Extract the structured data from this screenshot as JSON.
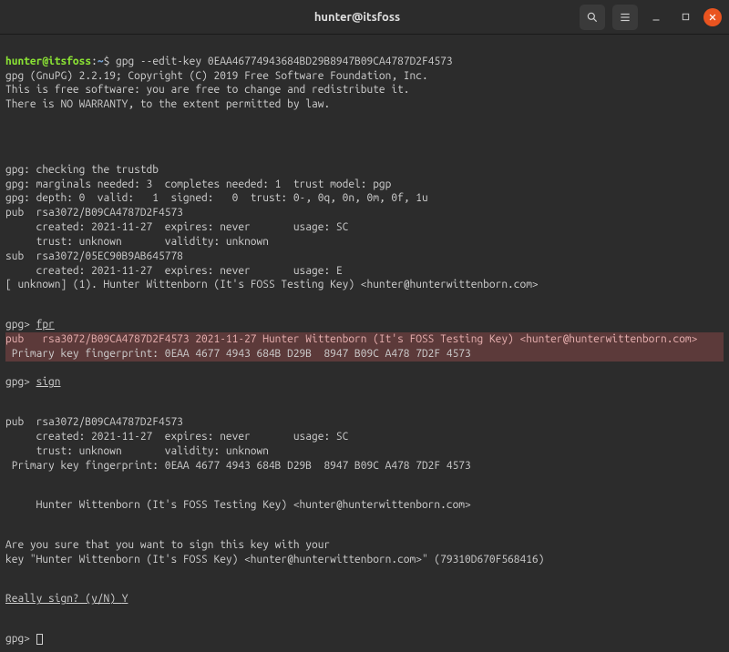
{
  "titlebar": {
    "title": "hunter@itsfoss"
  },
  "prompt": {
    "userhost": "hunter@itsfoss",
    "colon": ":",
    "tilde": "~",
    "dollar": "$ "
  },
  "cmd1": "gpg --edit-key 0EAA46774943684BD29B8947B09CA4787D2F4573",
  "out": {
    "l1": "gpg (GnuPG) 2.2.19; Copyright (C) 2019 Free Software Foundation, Inc.",
    "l2": "This is free software: you are free to change and redistribute it.",
    "l3": "There is NO WARRANTY, to the extent permitted by law.",
    "l4": "gpg: checking the trustdb",
    "l5": "gpg: marginals needed: 3  completes needed: 1  trust model: pgp",
    "l6": "gpg: depth: 0  valid:   1  signed:   0  trust: 0-, 0q, 0n, 0m, 0f, 1u",
    "l7": "pub  rsa3072/B09CA4787D2F4573",
    "l8": "     created: 2021-11-27  expires: never       usage: SC  ",
    "l9": "     trust: unknown       validity: unknown",
    "l10": "sub  rsa3072/05EC90B9AB645778",
    "l11": "     created: 2021-11-27  expires: never       usage: E   ",
    "l12": "[ unknown] (1). Hunter Wittenborn (It's FOSS Testing Key) <hunter@hunterwittenborn.com>"
  },
  "gpg_prompt": "gpg> ",
  "fpr_cmd": "fpr",
  "hl": {
    "l1": "pub   rsa3072/B09CA4787D2F4573 2021-11-27 Hunter Wittenborn (It's FOSS Testing Key) <hunter@hunterwittenborn.com>",
    "l2": " Primary key fingerprint: 0EAA 4677 4943 684B D29B  8947 B09C A478 7D2F 4573"
  },
  "sign_cmd": "sign",
  "sign_out": {
    "l1": "pub  rsa3072/B09CA4787D2F4573",
    "l2": "     created: 2021-11-27  expires: never       usage: SC  ",
    "l3": "     trust: unknown       validity: unknown",
    "l4": " Primary key fingerprint: 0EAA 4677 4943 684B D29B  8947 B09C A478 7D2F 4573",
    "l5": "     Hunter Wittenborn (It's FOSS Testing Key) <hunter@hunterwittenborn.com>",
    "l6": "Are you sure that you want to sign this key with your",
    "l7": "key \"Hunter Wittenborn (It's FOSS Key) <hunter@hunterwittenborn.com>\" (79310D670F568416)"
  },
  "really": "Really sign? (y/N) ",
  "really_ans": "Y"
}
